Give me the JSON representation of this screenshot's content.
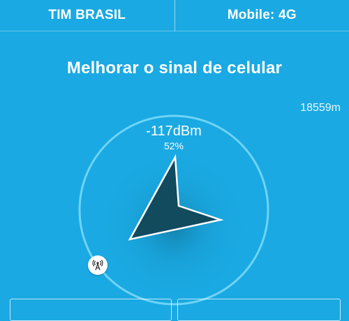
{
  "header": {
    "carrier": "TIM BRASIL",
    "network": "Mobile: 4G"
  },
  "main": {
    "title": "Melhorar o sinal de celular",
    "distance": "18559m"
  },
  "signal": {
    "dbm": "-117dBm",
    "percent": "52%",
    "percent_value": 0.52
  },
  "icons": {
    "tower": "cell-tower-icon",
    "compass": "compass-arrow-icon"
  },
  "colors": {
    "background": "#1aa9e2",
    "ring": "#6fd4f7",
    "arrow": "#124a5e"
  }
}
